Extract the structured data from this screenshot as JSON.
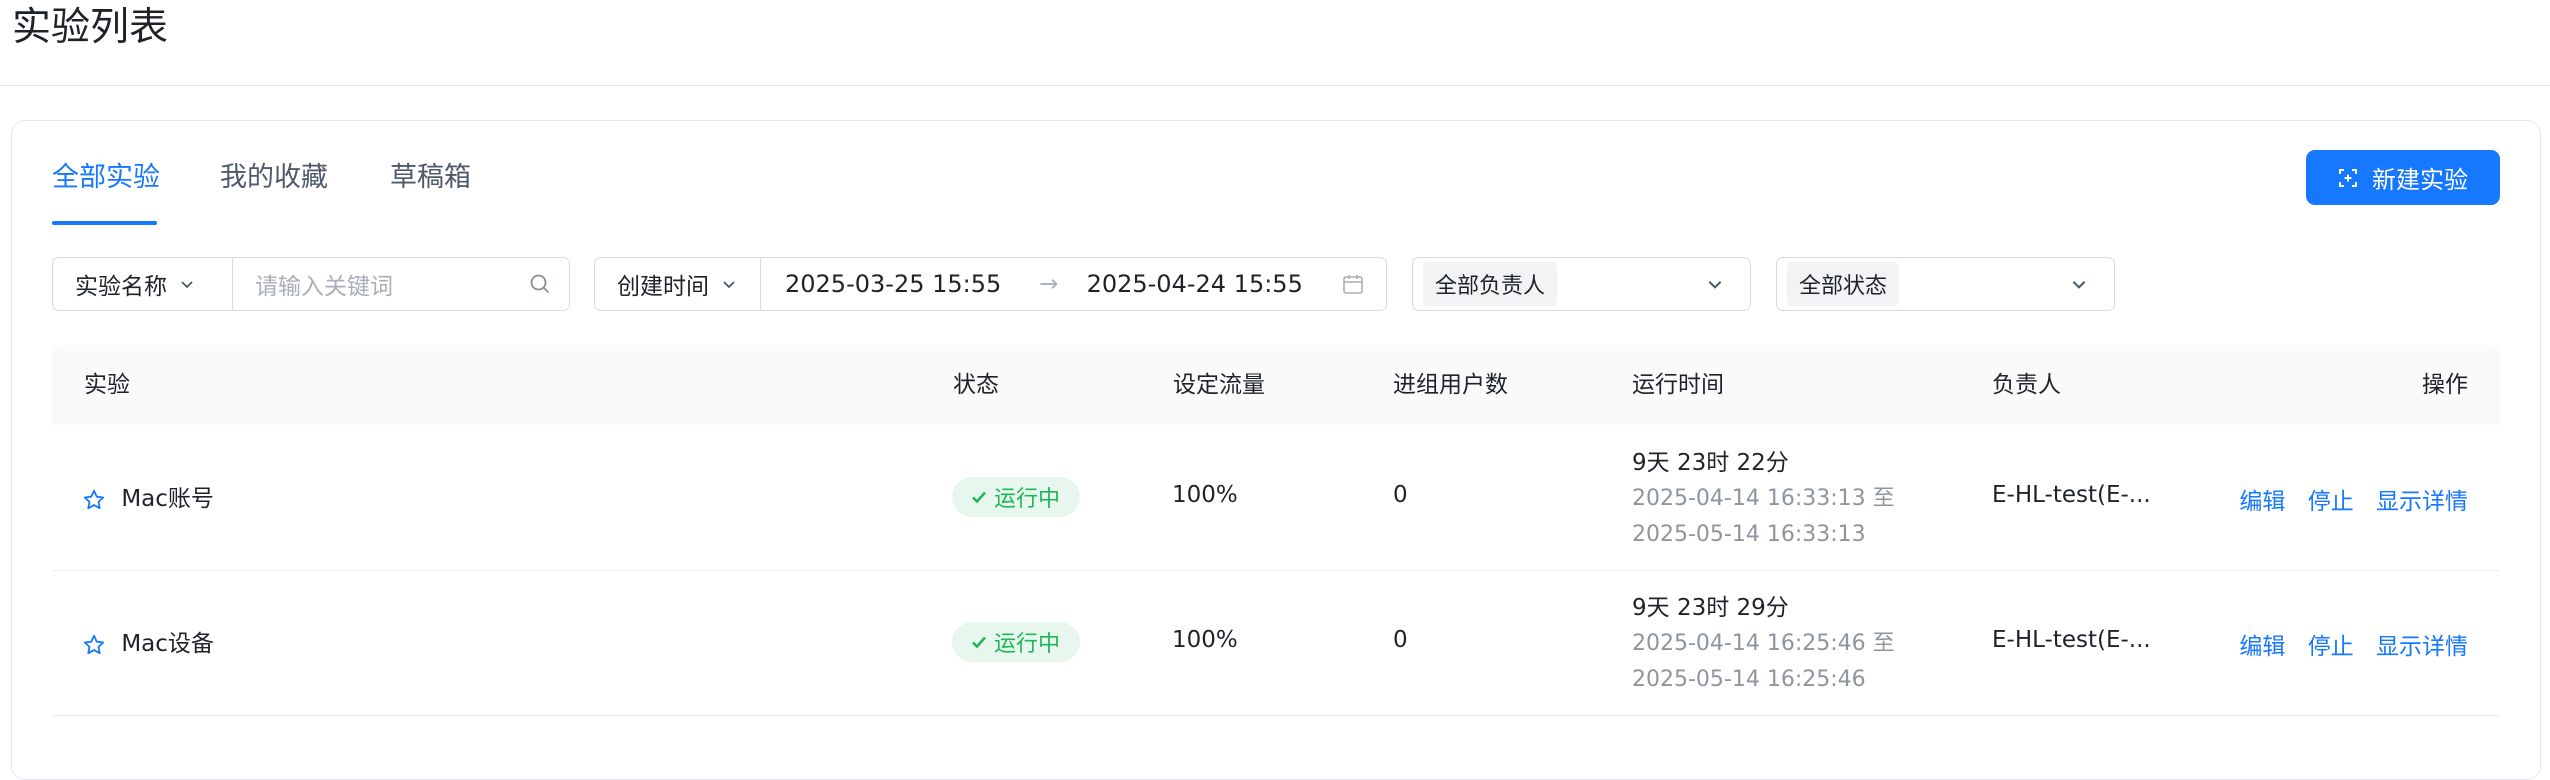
{
  "page": {
    "title": "实验列表"
  },
  "tabs": [
    {
      "label": "全部实验",
      "active": true
    },
    {
      "label": "我的收藏",
      "active": false
    },
    {
      "label": "草稿箱",
      "active": false
    }
  ],
  "actions": {
    "new_experiment_label": "新建实验"
  },
  "filters": {
    "name_field": {
      "label": "实验名称",
      "placeholder": "请输入关键词",
      "value": ""
    },
    "time_field": {
      "label": "创建时间",
      "start": "2025-03-25 15:55",
      "separator": "→",
      "end": "2025-04-24 15:55"
    },
    "owner_select": {
      "value": "全部负责人"
    },
    "status_select": {
      "value": "全部状态"
    }
  },
  "table": {
    "columns": [
      "实验",
      "状态",
      "设定流量",
      "进组用户数",
      "运行时间",
      "负责人",
      "操作"
    ],
    "rows": [
      {
        "name": "Mac账号",
        "status": "运行中",
        "traffic": "100%",
        "users": "0",
        "duration": "9天 23时 22分",
        "range_start": "2025-04-14 16:33:13 至",
        "range_end": "2025-05-14 16:33:13",
        "owner": "E-HL-test(E-...",
        "ops": [
          "编辑",
          "停止",
          "显示详情"
        ]
      },
      {
        "name": "Mac设备",
        "status": "运行中",
        "traffic": "100%",
        "users": "0",
        "duration": "9天 23时 29分",
        "range_start": "2025-04-14 16:25:46 至",
        "range_end": "2025-05-14 16:25:46",
        "owner": "E-HL-test(E-...",
        "ops": [
          "编辑",
          "停止",
          "显示详情"
        ]
      }
    ]
  },
  "colors": {
    "primary": "#1677ff",
    "success": "#1fb659",
    "success_bg": "#e8f7ee"
  },
  "icons": {
    "new_button": "scan-add-icon",
    "search": "search-icon",
    "calendar": "calendar-icon",
    "dropdown": "chevron-down-icon",
    "favorite": "star-outline-icon",
    "status": "check-icon"
  }
}
